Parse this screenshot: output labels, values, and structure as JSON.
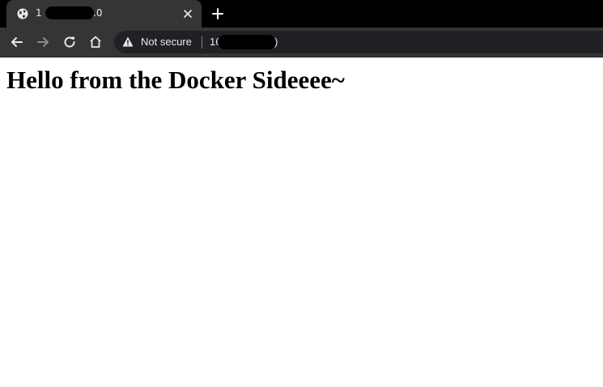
{
  "tab": {
    "title_start": "1",
    "title_end": ".0",
    "close_icon": "close-icon",
    "favicon": "globe-icon"
  },
  "toolbar": {
    "back_icon": "arrow-left-icon",
    "forward_icon": "arrow-right-icon",
    "reload_icon": "reload-icon",
    "home_icon": "home-icon",
    "newtab_icon": "plus-icon"
  },
  "omnibox": {
    "security_label": "Not secure",
    "url_start": "16",
    "url_end": ")"
  },
  "page": {
    "heading": "Hello from the Docker Sideeee~"
  },
  "colors": {
    "tabstrip_bg": "#000000",
    "toolbar_bg": "#353535",
    "omnibox_bg": "#202124",
    "text_light": "#e8eaed",
    "page_bg": "#ffffff"
  }
}
